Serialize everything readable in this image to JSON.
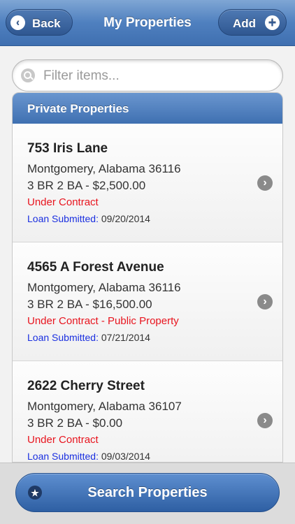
{
  "header": {
    "title": "My Properties",
    "back_label": "Back",
    "add_label": "Add"
  },
  "search": {
    "placeholder": "Filter items..."
  },
  "list": {
    "section_title": "Private Properties",
    "items": [
      {
        "address": "753 Iris Lane",
        "city": "Montgomery, Alabama 36116",
        "details": "3 BR 2 BA - $2,500.00",
        "status": "Under Contract",
        "status_extra": "",
        "loan_label": "Loan Submitted:",
        "loan_date": "09/20/2014"
      },
      {
        "address": "4565 A Forest Avenue",
        "city": "Montgomery, Alabama 36116",
        "details": "3 BR 2 BA - $16,500.00",
        "status": "Under Contract",
        "status_extra": " - Public Property",
        "loan_label": "Loan Submitted:",
        "loan_date": "07/21/2014"
      },
      {
        "address": "2622 Cherry Street",
        "city": "Montgomery, Alabama 36107",
        "details": "3 BR 2 BA - $0.00",
        "status": "Under Contract",
        "status_extra": "",
        "loan_label": "Loan Submitted:",
        "loan_date": "09/03/2014"
      }
    ]
  },
  "footer": {
    "search_button_label": "Search Properties"
  },
  "icons": {
    "back": "chevron-left-icon",
    "add": "plus-icon",
    "search": "search-icon",
    "row": "chevron-right-icon",
    "star": "star-icon"
  },
  "colors": {
    "header": "#4f80bf",
    "status": "#e8141e",
    "loan_label": "#1a2fe0"
  }
}
